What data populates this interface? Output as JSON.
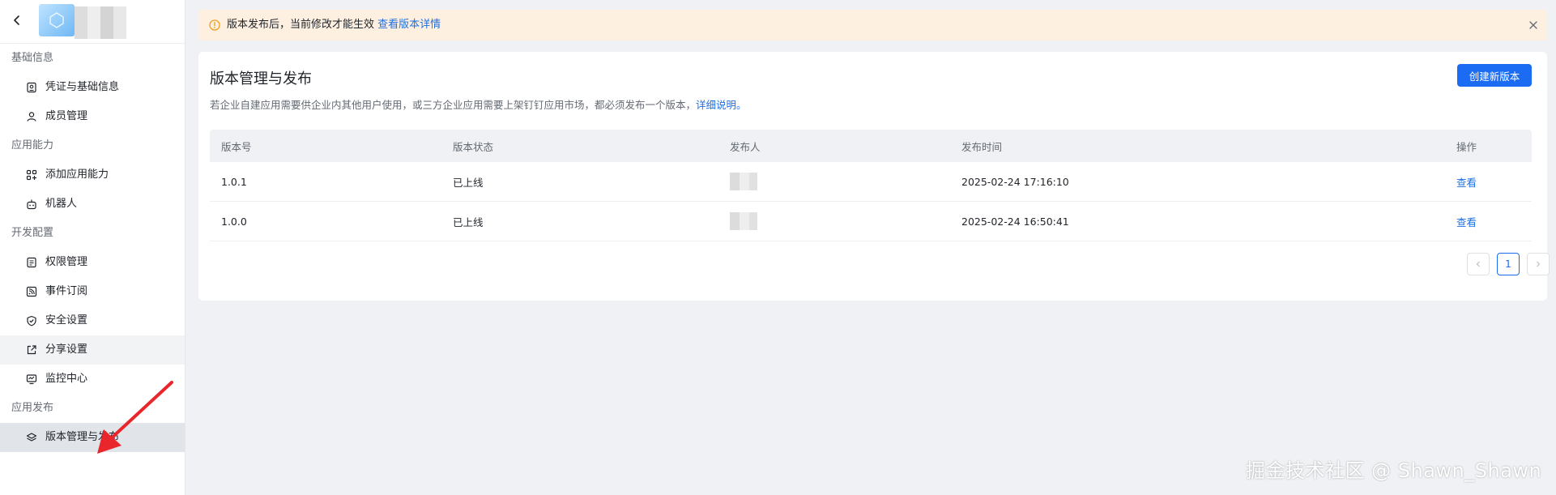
{
  "sidebar": {
    "sections": [
      {
        "title": "基础信息",
        "items": [
          "凭证与基础信息",
          "成员管理"
        ]
      },
      {
        "title": "应用能力",
        "items": [
          "添加应用能力",
          "机器人"
        ]
      },
      {
        "title": "开发配置",
        "items": [
          "权限管理",
          "事件订阅",
          "安全设置",
          "分享设置",
          "监控中心"
        ]
      },
      {
        "title": "应用发布",
        "items": [
          "版本管理与发布"
        ]
      }
    ],
    "active_item": "版本管理与发布",
    "hover_item": "分享设置"
  },
  "banner": {
    "text": "版本发布后，当前修改才能生效",
    "link": "查看版本详情"
  },
  "card": {
    "title": "版本管理与发布",
    "desc": "若企业自建应用需要供企业内其他用户使用，或三方企业应用需要上架钉钉应用市场，都必须发布一个版本，",
    "desc_link": "详细说明。",
    "create_button": "创建新版本"
  },
  "table": {
    "headers": [
      "版本号",
      "版本状态",
      "发布人",
      "发布时间",
      "操作"
    ],
    "rows": [
      {
        "version": "1.0.1",
        "status": "已上线",
        "time": "2025-02-24 17:16:10",
        "action": "查看"
      },
      {
        "version": "1.0.0",
        "status": "已上线",
        "time": "2025-02-24 16:50:41",
        "action": "查看"
      }
    ]
  },
  "pagination": {
    "current": "1",
    "prev_icon": "chevron-left-icon",
    "next_icon": "chevron-right-icon"
  },
  "watermark": "掘金技术社区 @ Shawn_Shawn",
  "colors": {
    "accent": "#1b6cf2",
    "link": "#1f6fe0",
    "banner_bg": "#fdf0e1",
    "warn": "#f0a020",
    "annotation": "#e8262b"
  }
}
